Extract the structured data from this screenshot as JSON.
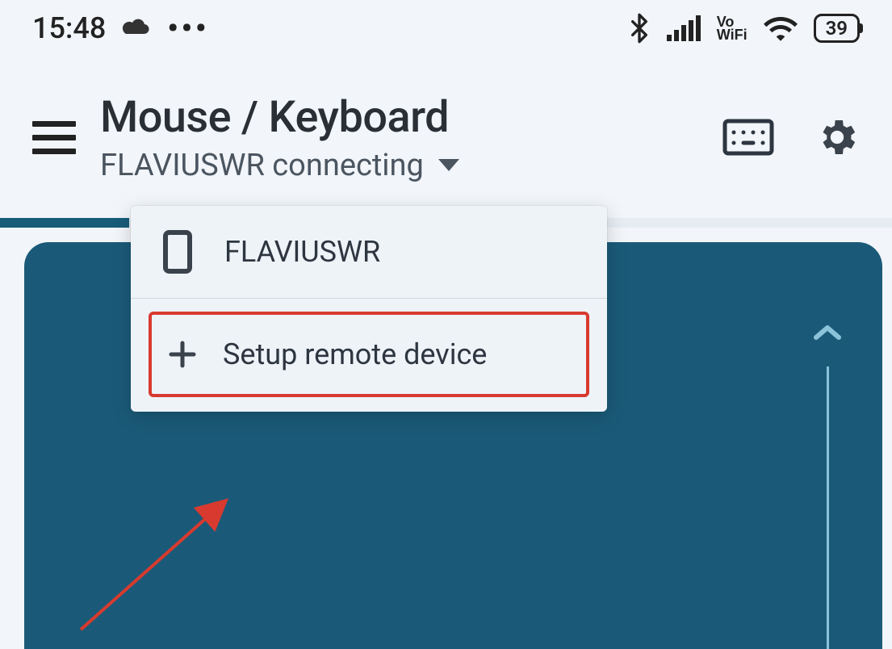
{
  "status": {
    "time": "15:48",
    "battery": "39"
  },
  "header": {
    "title": "Mouse / Keyboard",
    "subtitle": "FLAVIUSWR connecting"
  },
  "dropdown": {
    "device_item": "FLAVIUSWR",
    "setup_item": "Setup remote device"
  }
}
